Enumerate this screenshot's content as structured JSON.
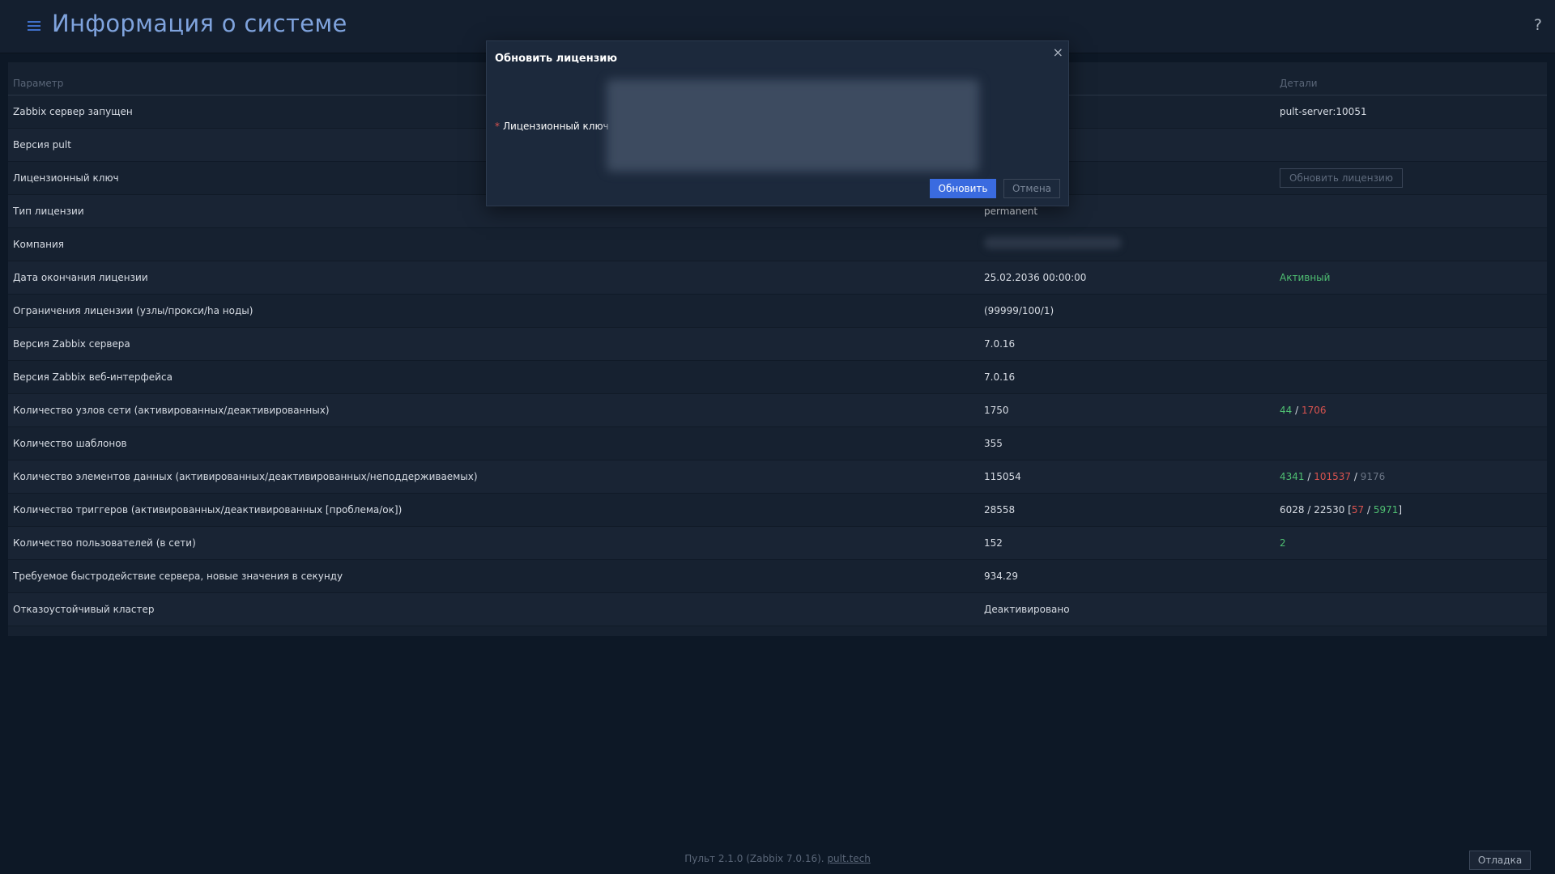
{
  "header": {
    "title": "Информация о системе",
    "help": "?"
  },
  "table": {
    "columns": [
      "Параметр",
      "",
      "Детали"
    ],
    "rows": [
      {
        "param": "Zabbix сервер запущен",
        "value": "",
        "details": [
          {
            "text": "pult-server:10051",
            "color": "white"
          }
        ]
      },
      {
        "param": "Версия pult",
        "value": "",
        "details": []
      },
      {
        "param": "Лицензионный ключ",
        "value": "",
        "details": [],
        "action": "Обновить лицензию"
      },
      {
        "param": "Тип лицензии",
        "value": "permanent",
        "details": []
      },
      {
        "param": "Компания",
        "value": "",
        "value_redacted": true,
        "details": []
      },
      {
        "param": "Дата окончания лицензии",
        "value": "25.02.2036 00:00:00",
        "details": [
          {
            "text": "Активный",
            "color": "green"
          }
        ]
      },
      {
        "param": "Ограничения лицензии (узлы/прокси/ha ноды)",
        "value": "(99999/100/1)",
        "details": []
      },
      {
        "param": "Версия Zabbix сервера",
        "value": "7.0.16",
        "details": []
      },
      {
        "param": "Версия Zabbix веб-интерфейса",
        "value": "7.0.16",
        "details": []
      },
      {
        "param": "Количество узлов сети (активированных/деактивированных)",
        "value": "1750",
        "details": [
          {
            "text": "44",
            "color": "green"
          },
          {
            "text": " / ",
            "color": "white"
          },
          {
            "text": "1706",
            "color": "red"
          }
        ]
      },
      {
        "param": "Количество шаблонов",
        "value": "355",
        "details": []
      },
      {
        "param": "Количество элементов данных (активированных/деактивированных/неподдерживаемых)",
        "value": "115054",
        "details": [
          {
            "text": "4341",
            "color": "green"
          },
          {
            "text": " / ",
            "color": "white"
          },
          {
            "text": "101537",
            "color": "red"
          },
          {
            "text": " / ",
            "color": "white"
          },
          {
            "text": "9176",
            "color": "grey"
          }
        ]
      },
      {
        "param": "Количество триггеров (активированных/деактивированных [проблема/ок])",
        "value": "28558",
        "details": [
          {
            "text": "6028 / 22530 [",
            "color": "white"
          },
          {
            "text": "57",
            "color": "red"
          },
          {
            "text": " / ",
            "color": "white"
          },
          {
            "text": "5971",
            "color": "green"
          },
          {
            "text": "]",
            "color": "white"
          }
        ]
      },
      {
        "param": "Количество пользователей (в сети)",
        "value": "152",
        "details": [
          {
            "text": "2",
            "color": "green"
          }
        ]
      },
      {
        "param": "Требуемое быстродействие сервера, новые значения в секунду",
        "value": "934.29",
        "details": []
      },
      {
        "param": "Отказоустойчивый кластер",
        "value": "Деактивировано",
        "details": []
      }
    ]
  },
  "modal": {
    "title": "Обновить лицензию",
    "close": "×",
    "field_label": "Лицензионный ключ",
    "required_mark": "*",
    "submit_label": "Обновить",
    "cancel_label": "Отмена"
  },
  "footer": {
    "text": "Пульт 2.1.0 (Zabbix 7.0.16). ",
    "link": "pult.tech",
    "debug_label": "Отладка"
  },
  "colors": {
    "green": "#4fbf72",
    "red": "#d9534f",
    "grey": "#6b7585",
    "accent": "#3a6be0"
  }
}
